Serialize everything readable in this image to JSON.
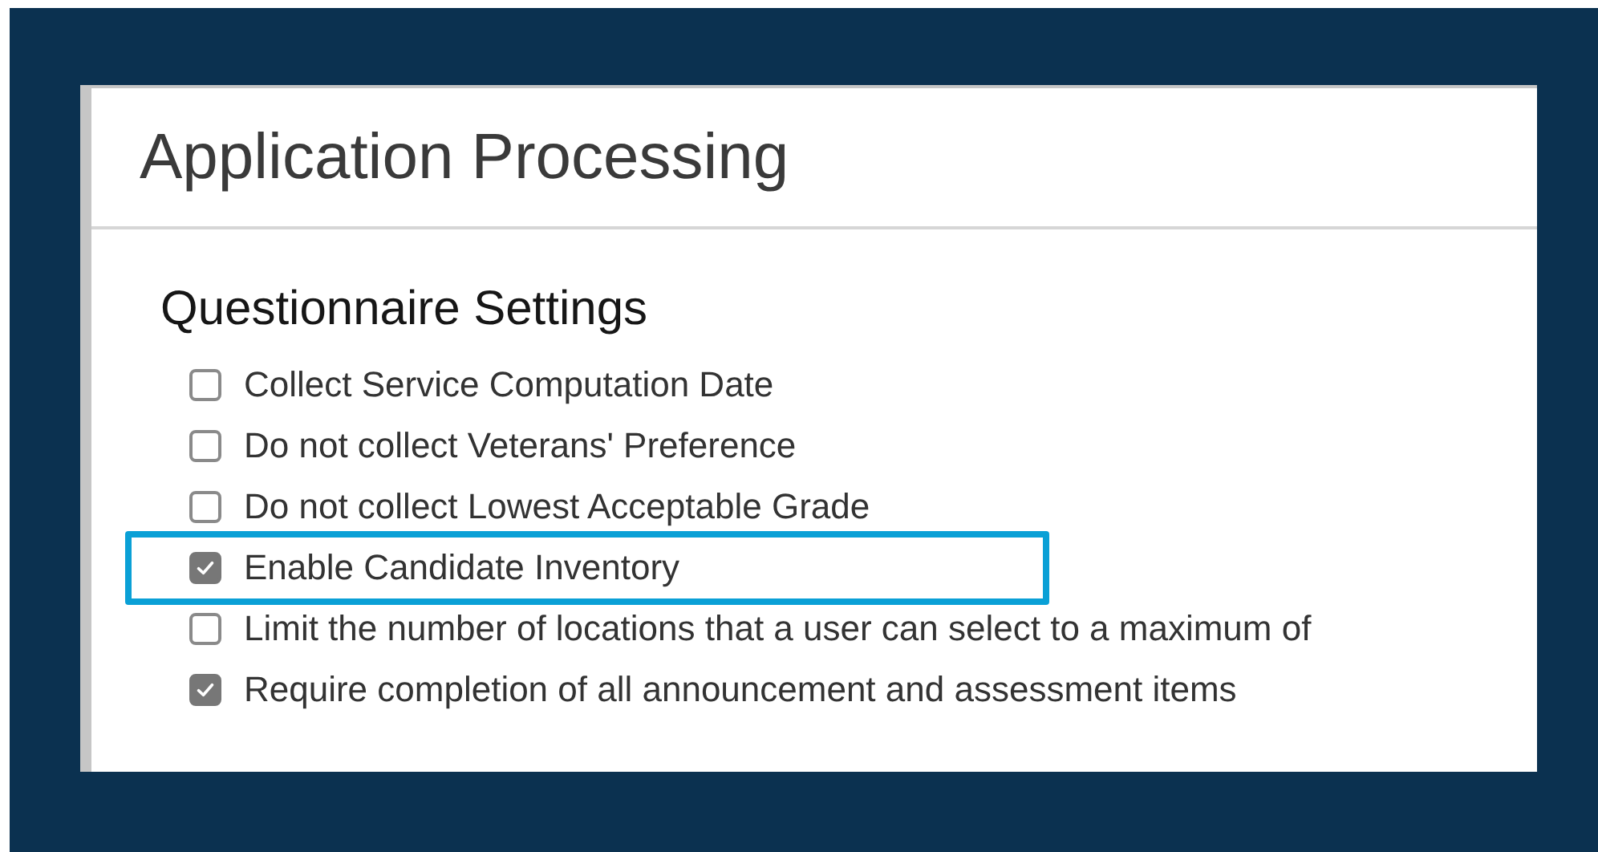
{
  "panel": {
    "title": "Application Processing"
  },
  "section": {
    "heading": "Questionnaire Settings",
    "options": [
      {
        "label": "Collect Service Computation Date",
        "checked": false,
        "highlighted": false
      },
      {
        "label": "Do not collect Veterans' Preference",
        "checked": false,
        "highlighted": false
      },
      {
        "label": "Do not collect Lowest Acceptable Grade",
        "checked": false,
        "highlighted": false
      },
      {
        "label": "Enable Candidate Inventory",
        "checked": true,
        "highlighted": true
      },
      {
        "label": "Limit the number of locations that a user can select to a maximum of",
        "checked": false,
        "highlighted": false
      },
      {
        "label": "Require completion of all announcement and assessment items",
        "checked": true,
        "highlighted": false
      }
    ]
  }
}
